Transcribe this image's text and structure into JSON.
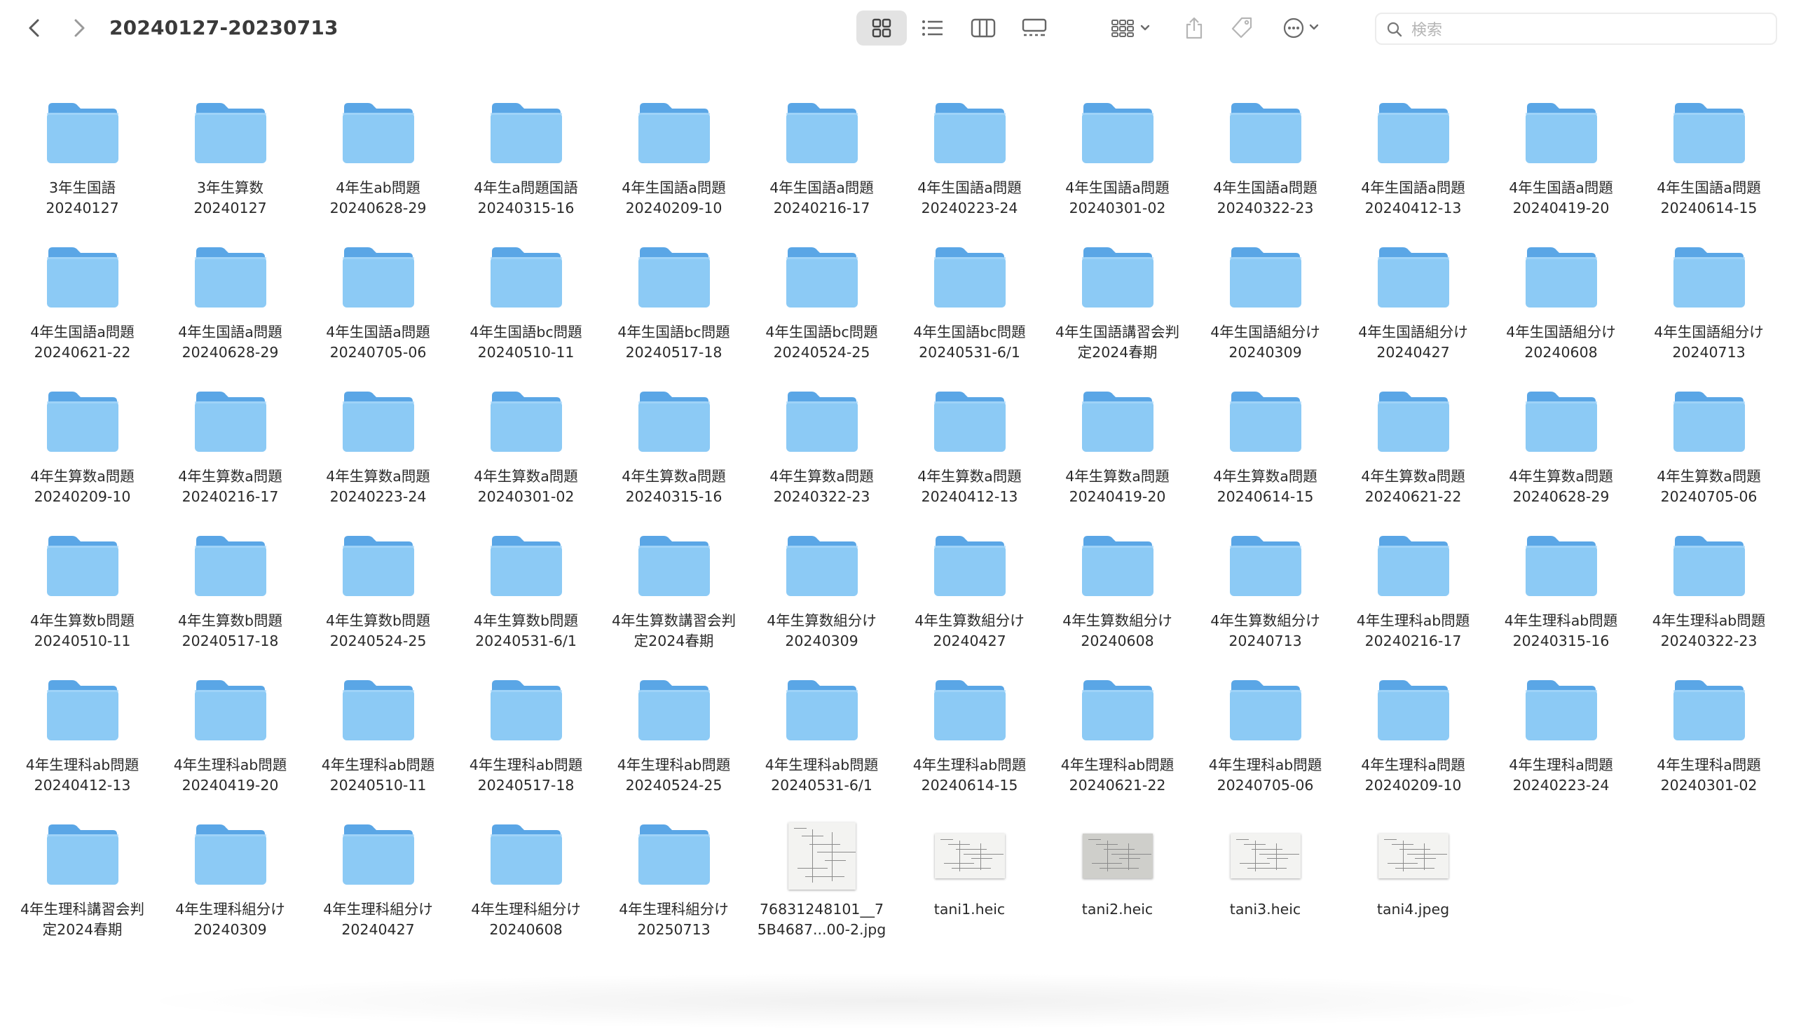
{
  "window": {
    "path_title": "20240127-20230713"
  },
  "toolbar": {
    "back": "chevron-left-icon",
    "forward": "chevron-right-icon",
    "views": [
      "icon-view",
      "list-view",
      "column-view",
      "gallery-view"
    ],
    "active_view": "icon-view",
    "group": "group-icon",
    "share": "share-icon",
    "tag": "tag-icon",
    "more": "ellipsis-icon"
  },
  "search": {
    "placeholder": "検索",
    "value": ""
  },
  "items": [
    {
      "type": "folder",
      "name": "3年生国語\n20240127"
    },
    {
      "type": "folder",
      "name": "3年生算数\n20240127"
    },
    {
      "type": "folder",
      "name": "4年生ab問題\n20240628-29"
    },
    {
      "type": "folder",
      "name": "4年生a問題国語\n20240315-16"
    },
    {
      "type": "folder",
      "name": "4年生国語a問題\n20240209-10"
    },
    {
      "type": "folder",
      "name": "4年生国語a問題\n20240216-17"
    },
    {
      "type": "folder",
      "name": "4年生国語a問題\n20240223-24"
    },
    {
      "type": "folder",
      "name": "4年生国語a問題\n20240301-02"
    },
    {
      "type": "folder",
      "name": "4年生国語a問題\n20240322-23"
    },
    {
      "type": "folder",
      "name": "4年生国語a問題\n20240412-13"
    },
    {
      "type": "folder",
      "name": "4年生国語a問題\n20240419-20"
    },
    {
      "type": "folder",
      "name": "4年生国語a問題\n20240614-15"
    },
    {
      "type": "folder",
      "name": "4年生国語a問題\n20240621-22"
    },
    {
      "type": "folder",
      "name": "4年生国語a問題\n20240628-29"
    },
    {
      "type": "folder",
      "name": "4年生国語a問題\n20240705-06"
    },
    {
      "type": "folder",
      "name": "4年生国語bc問題\n20240510-11"
    },
    {
      "type": "folder",
      "name": "4年生国語bc問題\n20240517-18"
    },
    {
      "type": "folder",
      "name": "4年生国語bc問題\n20240524-25"
    },
    {
      "type": "folder",
      "name": "4年生国語bc問題\n20240531-6/1"
    },
    {
      "type": "folder",
      "name": "4年生国語講習会判\n定2024春期"
    },
    {
      "type": "folder",
      "name": "4年生国語組分け\n20240309"
    },
    {
      "type": "folder",
      "name": "4年生国語組分け\n20240427"
    },
    {
      "type": "folder",
      "name": "4年生国語組分け\n20240608"
    },
    {
      "type": "folder",
      "name": "4年生国語組分け\n20240713"
    },
    {
      "type": "folder",
      "name": "4年生算数a問題\n20240209-10"
    },
    {
      "type": "folder",
      "name": "4年生算数a問題\n20240216-17"
    },
    {
      "type": "folder",
      "name": "4年生算数a問題\n20240223-24"
    },
    {
      "type": "folder",
      "name": "4年生算数a問題\n20240301-02"
    },
    {
      "type": "folder",
      "name": "4年生算数a問題\n20240315-16"
    },
    {
      "type": "folder",
      "name": "4年生算数a問題\n20240322-23"
    },
    {
      "type": "folder",
      "name": "4年生算数a問題\n20240412-13"
    },
    {
      "type": "folder",
      "name": "4年生算数a問題\n20240419-20"
    },
    {
      "type": "folder",
      "name": "4年生算数a問題\n20240614-15"
    },
    {
      "type": "folder",
      "name": "4年生算数a問題\n20240621-22"
    },
    {
      "type": "folder",
      "name": "4年生算数a問題\n20240628-29"
    },
    {
      "type": "folder",
      "name": "4年生算数a問題\n20240705-06"
    },
    {
      "type": "folder",
      "name": "4年生算数b問題\n20240510-11"
    },
    {
      "type": "folder",
      "name": "4年生算数b問題\n20240517-18"
    },
    {
      "type": "folder",
      "name": "4年生算数b問題\n20240524-25"
    },
    {
      "type": "folder",
      "name": "4年生算数b問題\n20240531-6/1"
    },
    {
      "type": "folder",
      "name": "4年生算数講習会判\n定2024春期"
    },
    {
      "type": "folder",
      "name": "4年生算数組分け\n20240309"
    },
    {
      "type": "folder",
      "name": "4年生算数組分け\n20240427"
    },
    {
      "type": "folder",
      "name": "4年生算数組分け\n20240608"
    },
    {
      "type": "folder",
      "name": "4年生算数組分け\n20240713"
    },
    {
      "type": "folder",
      "name": "4年生理科ab問題\n20240216-17"
    },
    {
      "type": "folder",
      "name": "4年生理科ab問題\n20240315-16"
    },
    {
      "type": "folder",
      "name": "4年生理科ab問題\n20240322-23"
    },
    {
      "type": "folder",
      "name": "4年生理科ab問題\n20240412-13"
    },
    {
      "type": "folder",
      "name": "4年生理科ab問題\n20240419-20"
    },
    {
      "type": "folder",
      "name": "4年生理科ab問題\n20240510-11"
    },
    {
      "type": "folder",
      "name": "4年生理科ab問題\n20240517-18"
    },
    {
      "type": "folder",
      "name": "4年生理科ab問題\n20240524-25"
    },
    {
      "type": "folder",
      "name": "4年生理科ab問題\n20240531-6/1"
    },
    {
      "type": "folder",
      "name": "4年生理科ab問題\n20240614-15"
    },
    {
      "type": "folder",
      "name": "4年生理科ab問題\n20240621-22"
    },
    {
      "type": "folder",
      "name": "4年生理科ab問題\n20240705-06"
    },
    {
      "type": "folder",
      "name": "4年生理科a問題\n20240209-10"
    },
    {
      "type": "folder",
      "name": "4年生理科a問題\n20240223-24"
    },
    {
      "type": "folder",
      "name": "4年生理科a問題\n20240301-02"
    },
    {
      "type": "folder",
      "name": "4年生理科講習会判\n定2024春期"
    },
    {
      "type": "folder",
      "name": "4年生理科組分け\n20240309"
    },
    {
      "type": "folder",
      "name": "4年生理科組分け\n20240427"
    },
    {
      "type": "folder",
      "name": "4年生理科組分け\n20240608"
    },
    {
      "type": "folder",
      "name": "4年生理科組分け\n20250713"
    },
    {
      "type": "image",
      "shape": "portrait",
      "name": "76831248101__7\n5B4687...00-2.jpg"
    },
    {
      "type": "image",
      "shape": "landscape",
      "name": "tani1.heic"
    },
    {
      "type": "image",
      "shape": "landscape-dark",
      "name": "tani2.heic"
    },
    {
      "type": "image",
      "shape": "landscape",
      "name": "tani3.heic"
    },
    {
      "type": "image",
      "shape": "landscape",
      "name": "tani4.jpeg"
    }
  ],
  "colors": {
    "folder_body": "#8ccaf5",
    "folder_tab": "#5aa6e6",
    "accent": "#3a3a3a"
  }
}
